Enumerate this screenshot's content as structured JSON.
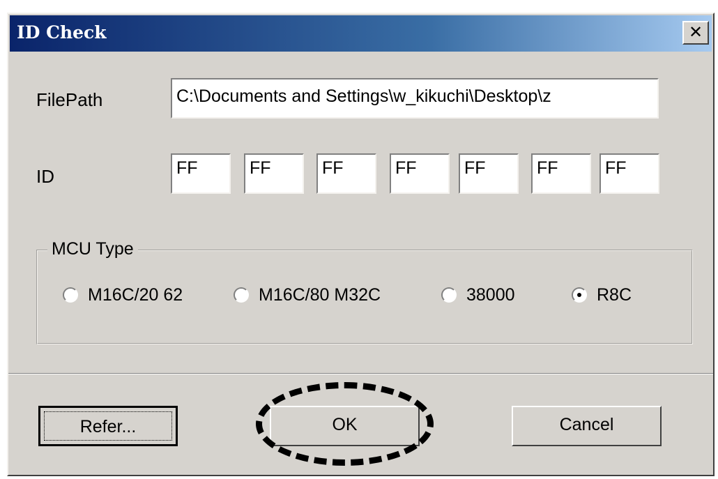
{
  "window": {
    "title": "ID Check",
    "close_glyph": "✕"
  },
  "form": {
    "filepath_label": "FilePath",
    "filepath_value": "C:\\Documents and Settings\\w_kikuchi\\Desktop\\z",
    "id_label": "ID",
    "id_values": [
      "FF",
      "FF",
      "FF",
      "FF",
      "FF",
      "FF",
      "FF"
    ]
  },
  "mcu_type": {
    "label": "MCU Type",
    "options": [
      {
        "label": "M16C/20 62",
        "checked": false
      },
      {
        "label": "M16C/80  M32C",
        "checked": false
      },
      {
        "label": "38000",
        "checked": false
      },
      {
        "label": "R8C",
        "checked": true
      }
    ]
  },
  "buttons": {
    "refer_label": "Refer...",
    "ok_label": "OK",
    "cancel_label": "Cancel"
  },
  "colors": {
    "dialog_bg": "#d6d3ce",
    "title_gradient_start": "#0a246a",
    "title_gradient_end": "#a6caf0"
  }
}
